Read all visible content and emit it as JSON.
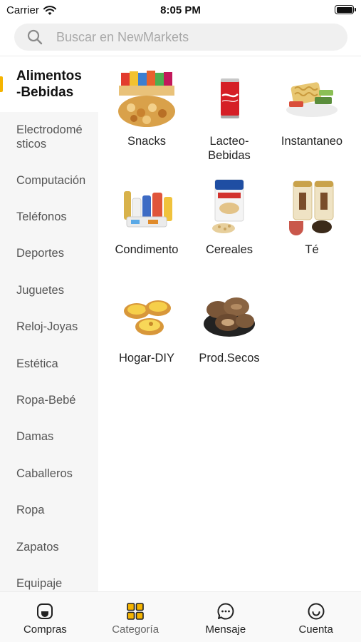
{
  "status_bar": {
    "carrier": "Carrier",
    "time": "8:05 PM"
  },
  "search": {
    "placeholder": "Buscar en NewMarkets"
  },
  "sidebar": {
    "items": [
      {
        "label": "Alimentos\n-Bebidas",
        "active": true
      },
      {
        "label": "Electrodomé\nsticos"
      },
      {
        "label": "Computación"
      },
      {
        "label": "Teléfonos"
      },
      {
        "label": "Deportes"
      },
      {
        "label": "Juguetes"
      },
      {
        "label": "Reloj-Joyas"
      },
      {
        "label": "Estética"
      },
      {
        "label": "Ropa-Bebé"
      },
      {
        "label": "Damas"
      },
      {
        "label": "Caballeros"
      },
      {
        "label": "Ropa"
      },
      {
        "label": "Zapatos"
      },
      {
        "label": "Equipaje"
      }
    ]
  },
  "categories": [
    {
      "label": "Snacks",
      "image": "snacks-image"
    },
    {
      "label": "Lacteo-\nBebidas",
      "image": "cola-can-image"
    },
    {
      "label": "Instantaneo",
      "image": "instant-noodles-image"
    },
    {
      "label": "Condimento",
      "image": "condiments-image"
    },
    {
      "label": "Cereales",
      "image": "cereal-bag-image"
    },
    {
      "label": "Té",
      "image": "tea-cans-image"
    },
    {
      "label": "Hogar-DIY",
      "image": "egg-tarts-image"
    },
    {
      "label": "Prod.Secos",
      "image": "dried-mushrooms-image"
    }
  ],
  "tabbar": {
    "tabs": [
      {
        "label": "Compras",
        "icon": "shopping-bag-icon"
      },
      {
        "label": "Categoría",
        "icon": "grid-icon",
        "active": true
      },
      {
        "label": "Mensaje",
        "icon": "chat-bubble-icon"
      },
      {
        "label": "Cuenta",
        "icon": "smiley-icon"
      }
    ]
  },
  "colors": {
    "accent": "#f5b400",
    "sidebar_bg": "#f6f6f6"
  }
}
